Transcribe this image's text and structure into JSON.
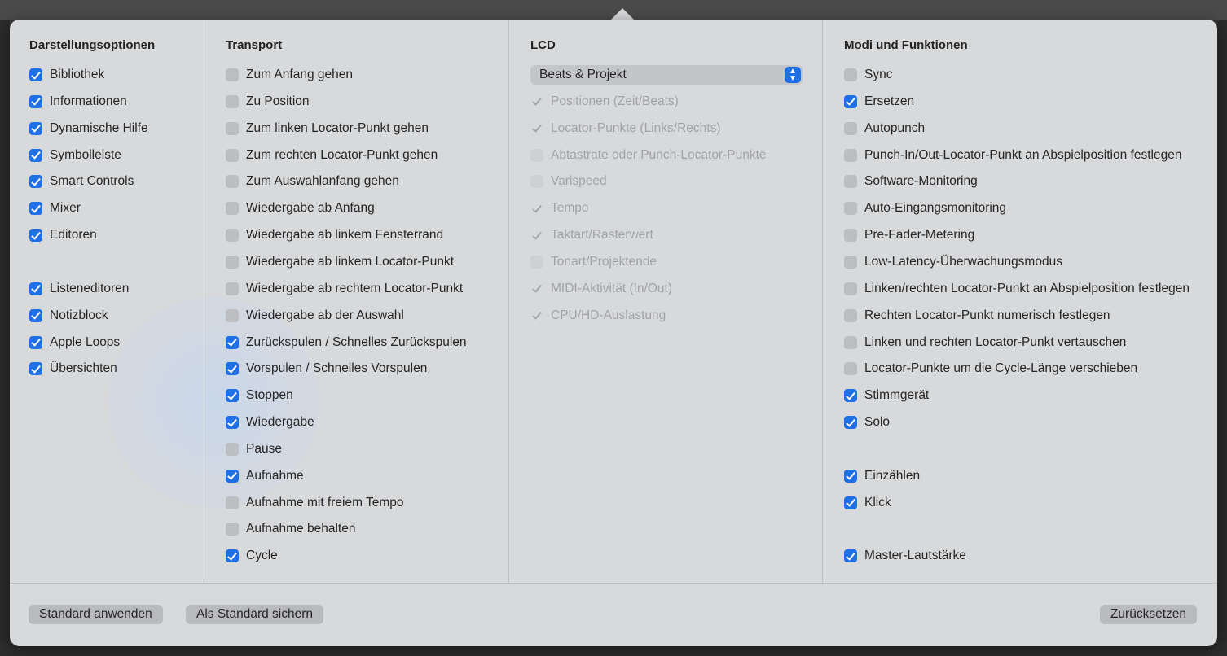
{
  "columns": [
    {
      "title": "Darstellungsoptionen",
      "items": [
        {
          "label": "Bibliothek",
          "state": "on"
        },
        {
          "label": "Informationen",
          "state": "on"
        },
        {
          "label": "Dynamische Hilfe",
          "state": "on"
        },
        {
          "label": "Symbolleiste",
          "state": "on"
        },
        {
          "label": "Smart Controls",
          "state": "on"
        },
        {
          "label": "Mixer",
          "state": "on"
        },
        {
          "label": "Editoren",
          "state": "on"
        },
        {
          "label": "Listeneditoren",
          "state": "on"
        },
        {
          "label": "Notizblock",
          "state": "on"
        },
        {
          "label": "Apple Loops",
          "state": "on"
        },
        {
          "label": "Übersichten",
          "state": "on"
        }
      ]
    },
    {
      "title": "Transport",
      "items": [
        {
          "label": "Zum Anfang gehen",
          "state": "off"
        },
        {
          "label": "Zu Position",
          "state": "off"
        },
        {
          "label": "Zum linken Locator-Punkt gehen",
          "state": "off"
        },
        {
          "label": "Zum rechten Locator-Punkt gehen",
          "state": "off"
        },
        {
          "label": "Zum Auswahlanfang gehen",
          "state": "off"
        },
        {
          "label": "Wiedergabe ab Anfang",
          "state": "off"
        },
        {
          "label": "Wiedergabe ab linkem Fensterrand",
          "state": "off"
        },
        {
          "label": "Wiedergabe ab linkem Locator-Punkt",
          "state": "off"
        },
        {
          "label": "Wiedergabe ab rechtem Locator-Punkt",
          "state": "off"
        },
        {
          "label": "Wiedergabe ab der Auswahl",
          "state": "off"
        },
        {
          "label": "Zurückspulen / Schnelles Zurückspulen",
          "state": "on"
        },
        {
          "label": "Vorspulen / Schnelles Vorspulen",
          "state": "on"
        },
        {
          "label": "Stoppen",
          "state": "on"
        },
        {
          "label": "Wiedergabe",
          "state": "on"
        },
        {
          "label": "Pause",
          "state": "off"
        },
        {
          "label": "Aufnahme",
          "state": "on"
        },
        {
          "label": "Aufnahme mit freiem Tempo",
          "state": "off"
        },
        {
          "label": "Aufnahme behalten",
          "state": "off"
        },
        {
          "label": "Cycle",
          "state": "on"
        }
      ]
    },
    {
      "title": "LCD",
      "select_value": "Beats & Projekt",
      "items": [
        {
          "label": "Positionen (Zeit/Beats)",
          "state": "dis-on"
        },
        {
          "label": "Locator-Punkte (Links/Rechts)",
          "state": "dis-on"
        },
        {
          "label": "Abtastrate oder Punch-Locator-Punkte",
          "state": "dis-off"
        },
        {
          "label": "Varispeed",
          "state": "dis-off"
        },
        {
          "label": "Tempo",
          "state": "dis-on"
        },
        {
          "label": "Taktart/Rasterwert",
          "state": "dis-on"
        },
        {
          "label": "Tonart/Projektende",
          "state": "dis-off"
        },
        {
          "label": "MIDI-Aktivität (In/Out)",
          "state": "dis-on"
        },
        {
          "label": "CPU/HD-Auslastung",
          "state": "dis-on"
        }
      ]
    },
    {
      "title": "Modi und Funktionen",
      "items": [
        {
          "label": "Sync",
          "state": "off"
        },
        {
          "label": "Ersetzen",
          "state": "on"
        },
        {
          "label": "Autopunch",
          "state": "off"
        },
        {
          "label": "Punch-In/Out-Locator-Punkt an Abspielposition festlegen",
          "state": "off"
        },
        {
          "label": "Software-Monitoring",
          "state": "off"
        },
        {
          "label": "Auto-Eingangsmonitoring",
          "state": "off"
        },
        {
          "label": "Pre-Fader-Metering",
          "state": "off"
        },
        {
          "label": "Low-Latency-Überwachungsmodus",
          "state": "off"
        },
        {
          "label": "Linken/rechten Locator-Punkt an Abspielposition festlegen",
          "state": "off"
        },
        {
          "label": "Rechten Locator-Punkt numerisch festlegen",
          "state": "off"
        },
        {
          "label": "Linken und rechten Locator-Punkt vertauschen",
          "state": "off"
        },
        {
          "label": "Locator-Punkte um die Cycle-Länge verschieben",
          "state": "off"
        },
        {
          "label": "Stimmgerät",
          "state": "on"
        },
        {
          "label": "Solo",
          "state": "on"
        },
        {
          "label": "Einzählen",
          "state": "on"
        },
        {
          "label": "Klick",
          "state": "on"
        },
        {
          "label": "Master-Lautstärke",
          "state": "on"
        }
      ]
    }
  ],
  "footer": {
    "apply_default": "Standard anwenden",
    "save_default": "Als Standard sichern",
    "reset": "Zurücksetzen"
  },
  "colors": {
    "accent": "#1f6fe5",
    "panel": "#d8d9db"
  }
}
